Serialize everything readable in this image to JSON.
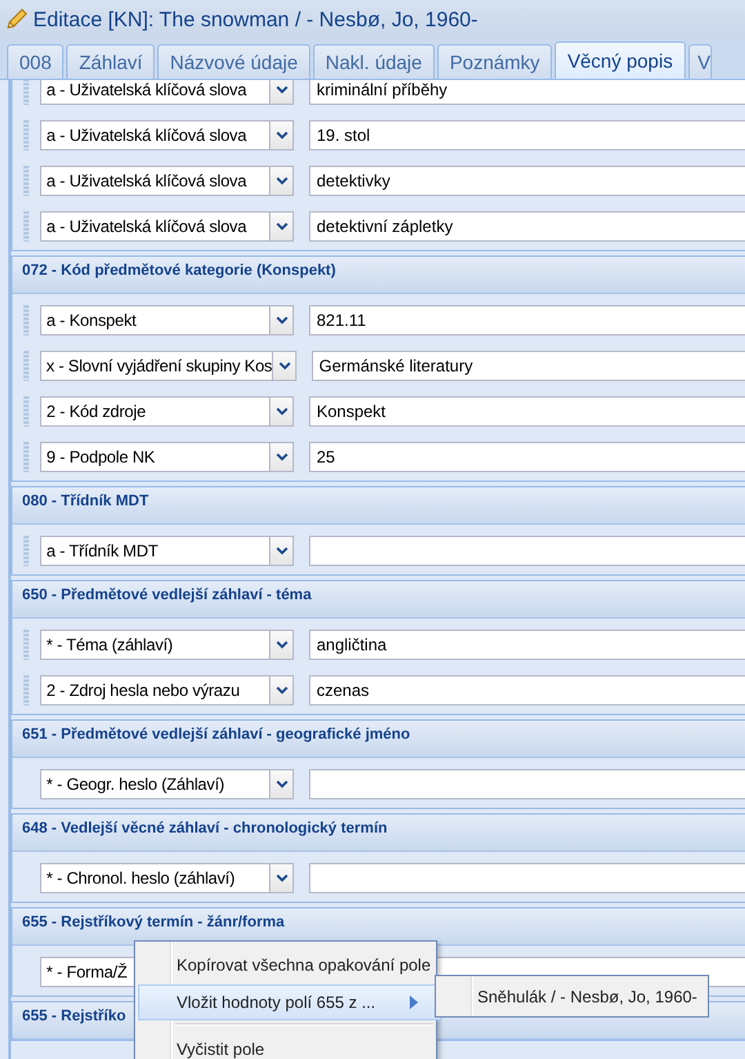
{
  "window": {
    "title": "Editace [KN]: The snowman / - Nesbø, Jo, 1960-"
  },
  "tabs": [
    {
      "label": "008",
      "selected": false
    },
    {
      "label": "Záhlaví",
      "selected": false
    },
    {
      "label": "Názvové údaje",
      "selected": false
    },
    {
      "label": "Nakl. údaje",
      "selected": false
    },
    {
      "label": "Poznámky",
      "selected": false
    },
    {
      "label": "Věcný popis",
      "selected": true
    },
    {
      "label": "V",
      "selected": false
    }
  ],
  "sections": [
    {
      "rows": [
        {
          "handle": true,
          "subfield": "a - Uživatelská klíčová slova",
          "value": "kriminální příběhy"
        },
        {
          "handle": true,
          "subfield": "a - Uživatelská klíčová slova",
          "value": "19. stol"
        },
        {
          "handle": true,
          "subfield": "a - Uživatelská klíčová slova",
          "value": "detektivky"
        },
        {
          "handle": true,
          "subfield": "a - Uživatelská klíčová slova",
          "value": "detektivní zápletky"
        }
      ]
    },
    {
      "header": "072 - Kód předmětové kategorie (Konspekt)",
      "rows": [
        {
          "handle": true,
          "subfield": "a - Konspekt",
          "value": "821.11"
        },
        {
          "handle": true,
          "subfield": "x - Slovní vyjádření skupiny Kos",
          "value": "Germánské literatury"
        },
        {
          "handle": true,
          "subfield": "2 - Kód zdroje",
          "value": "Konspekt"
        },
        {
          "handle": true,
          "subfield": "9 - Podpole NK",
          "value": "25"
        }
      ]
    },
    {
      "header": "080 - Třídník MDT",
      "rows": [
        {
          "handle": true,
          "subfield": "a - Třídník MDT"
        }
      ]
    },
    {
      "header": "650 - Předmětové vedlejší záhlaví - téma",
      "rows": [
        {
          "handle": true,
          "subfield": "* - Téma (záhlaví)",
          "value": "angličtina"
        },
        {
          "handle": true,
          "subfield": "2 - Zdroj hesla nebo výrazu",
          "value": "czenas"
        }
      ]
    },
    {
      "header": "651 - Předmětové vedlejší záhlaví - geografické jméno",
      "rows": [
        {
          "handle": false,
          "subfield": "* - Geogr. heslo (Záhlaví)"
        }
      ]
    },
    {
      "header": "648 - Vedlejší věcné záhlaví - chronologický termín",
      "rows": [
        {
          "handle": false,
          "subfield": "* - Chronol. heslo (záhlaví)"
        }
      ]
    },
    {
      "header": "655 - Rejstříkový termín - žánr/forma",
      "rows": [
        {
          "handle": false,
          "subfield": "* - Forma/Ž"
        }
      ]
    },
    {
      "header": "655 - Rejstříko"
    }
  ],
  "context_menu": {
    "items": [
      {
        "kind": "item",
        "label": "Kopírovat všechna opakování pole",
        "selected": false,
        "submenu": false
      },
      {
        "kind": "item",
        "label": "Vložit hodnoty polí 655 z ...",
        "selected": true,
        "submenu": true
      },
      {
        "kind": "separator"
      },
      {
        "kind": "item",
        "label": "Vyčistit pole",
        "selected": false,
        "submenu": false
      }
    ],
    "submenu": {
      "items": [
        {
          "label": "Sněhulák / - Nesbø, Jo, 1960-"
        }
      ]
    }
  }
}
